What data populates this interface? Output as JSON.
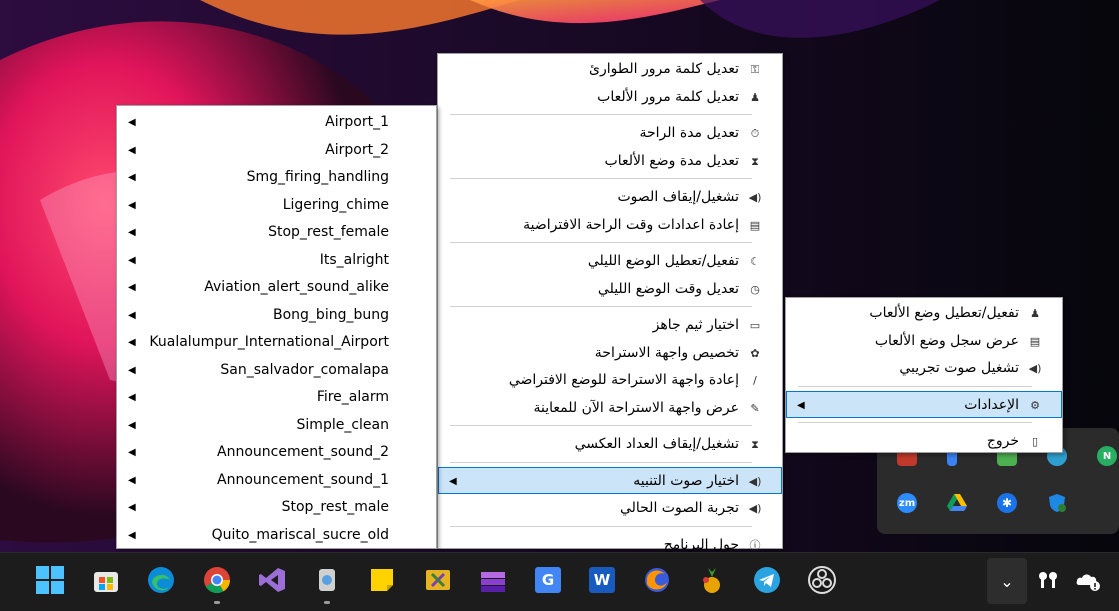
{
  "colors": {
    "menu_bg": "#ffffff",
    "selected_bg": "#cce4f7",
    "selected_border": "#0078d4",
    "taskbar_bg": "#1c1c1c",
    "tray_bg": "#2b2b2b"
  },
  "main_menu": {
    "groups": [
      [
        {
          "label": "تعديل كلمة مرور الطوارئ",
          "icon": "key-icon"
        },
        {
          "label": "تعديل كلمة مرور الألعاب",
          "icon": "gamepad-icon"
        }
      ],
      [
        {
          "label": "تعديل مدة الراحة",
          "icon": "stopwatch-icon"
        },
        {
          "label": "تعديل مدة وضع الألعاب",
          "icon": "hourglass-icon"
        }
      ],
      [
        {
          "label": "تشغيل/إيقاف الصوت",
          "icon": "speaker-icon"
        },
        {
          "label": "إعادة اعدادات وقت الراحة الافتراضية",
          "icon": "reset-icon"
        }
      ],
      [
        {
          "label": "تفعيل/تعطيل الوضع الليلي",
          "icon": "moon-icon"
        },
        {
          "label": "تعديل وقت الوضع الليلي",
          "icon": "clock-icon"
        }
      ],
      [
        {
          "label": "اختيار ثيم جاهز",
          "icon": "theme-icon"
        },
        {
          "label": "تخصيص واجهة الاستراحة",
          "icon": "palette-icon"
        },
        {
          "label": "إعادة واجهة الاستراحة للوضع الافتراضي",
          "icon": "brush-icon"
        },
        {
          "label": "عرض واجهة الاستراحة الآن للمعاينة",
          "icon": "pen-icon"
        }
      ],
      [
        {
          "label": "تشغيل/إيقاف العداد العكسي",
          "icon": "timer-icon"
        }
      ],
      [
        {
          "label": "اختيار صوت التنبيه",
          "icon": "bell-sound-icon",
          "submenu": true,
          "selected": true
        },
        {
          "label": "تجربة الصوت الحالي",
          "icon": "play-sound-icon"
        }
      ],
      [
        {
          "label": "حول البرنامج",
          "icon": "info-icon"
        }
      ]
    ]
  },
  "sound_menu": {
    "items": [
      "Airport_1",
      "Airport_2",
      "Smg_firing_handling",
      "Ligering_chime",
      "Stop_rest_female",
      "Its_alright",
      "Aviation_alert_sound_alike",
      "Bong_bing_bung",
      "Kualalumpur_International_Airport",
      "San_salvador_comalapa",
      "Fire_alarm",
      "Simple_clean",
      "Announcement_sound_2",
      "Announcement_sound_1",
      "Stop_rest_male",
      "Quito_mariscal_sucre_old"
    ]
  },
  "tray_menu": {
    "groups": [
      [
        {
          "label": "تفعيل/تعطيل وضع الألعاب",
          "icon": "gamepad-icon"
        },
        {
          "label": "عرض سجل وضع الألعاب",
          "icon": "log-icon"
        },
        {
          "label": "تشغيل صوت تجريبي",
          "icon": "speaker-icon"
        }
      ],
      [
        {
          "label": "الإعدادات",
          "icon": "gear-icon",
          "submenu": true,
          "selected": true
        }
      ],
      [
        {
          "label": "خروج",
          "icon": "exit-icon"
        }
      ]
    ]
  },
  "tray_overflow": {
    "icons": [
      "zoom-icon",
      "google-drive-icon",
      "bluetooth-icon",
      "windows-security-icon"
    ],
    "zoom_label": "zm"
  },
  "taskbar": {
    "apps": [
      {
        "name": "start-button"
      },
      {
        "name": "microsoft-store-icon"
      },
      {
        "name": "edge-icon"
      },
      {
        "name": "chrome-icon",
        "running": true
      },
      {
        "name": "visual-studio-icon"
      },
      {
        "name": "app-icon",
        "running": true
      },
      {
        "name": "sticky-notes-icon"
      },
      {
        "name": "tools-icon"
      },
      {
        "name": "stack-app-icon"
      },
      {
        "name": "translate-icon"
      },
      {
        "name": "word-icon"
      },
      {
        "name": "firefox-icon"
      },
      {
        "name": "pineapple-app-icon"
      },
      {
        "name": "telegram-icon"
      },
      {
        "name": "obs-icon"
      }
    ],
    "translate_glyph": "G",
    "word_glyph": "W"
  }
}
